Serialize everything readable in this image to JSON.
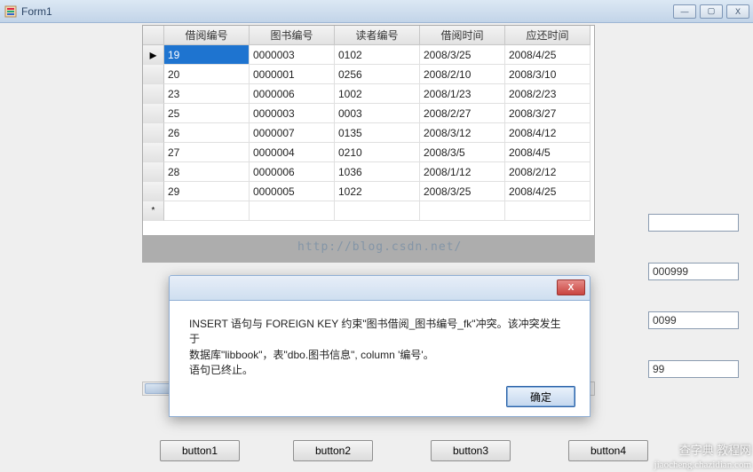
{
  "window": {
    "title": "Form1",
    "min_label": "—",
    "max_label": "▢",
    "close_label": "X"
  },
  "grid": {
    "columns": [
      "借阅编号",
      "图书编号",
      "读者编号",
      "借阅时间",
      "应还时间"
    ],
    "rows": [
      [
        "19",
        "0000003",
        "0102",
        "2008/3/25",
        "2008/4/25"
      ],
      [
        "20",
        "0000001",
        "0256",
        "2008/2/10",
        "2008/3/10"
      ],
      [
        "23",
        "0000006",
        "1002",
        "2008/1/23",
        "2008/2/23"
      ],
      [
        "25",
        "0000003",
        "0003",
        "2008/2/27",
        "2008/3/27"
      ],
      [
        "26",
        "0000007",
        "0135",
        "2008/3/12",
        "2008/4/12"
      ],
      [
        "27",
        "0000004",
        "0210",
        "2008/3/5",
        "2008/4/5"
      ],
      [
        "28",
        "0000006",
        "1036",
        "2008/1/12",
        "2008/2/12"
      ],
      [
        "29",
        "0000005",
        "1022",
        "2008/3/25",
        "2008/4/25"
      ]
    ],
    "selected_row": 0,
    "new_row_marker": "*",
    "current_row_marker": "▸"
  },
  "watermark_url": "http://blog.csdn.net/",
  "textboxes": {
    "tb1": "",
    "tb2": "000999",
    "tb3": "0099",
    "tb4": "99"
  },
  "buttons": {
    "b1": "button1",
    "b2": "button2",
    "b3": "button3",
    "b4": "button4"
  },
  "dialog": {
    "close_label": "X",
    "line1": "INSERT 语句与 FOREIGN KEY 约束\"图书借阅_图书编号_fk\"冲突。该冲突发生于",
    "line2": "数据库\"libbook\"，表\"dbo.图书信息\", column '编号'。",
    "line3": "语句已终止。",
    "ok": "确定"
  },
  "source_watermark1": "查字典 教程网",
  "source_watermark2": "jiaocheng.chazidian.com"
}
